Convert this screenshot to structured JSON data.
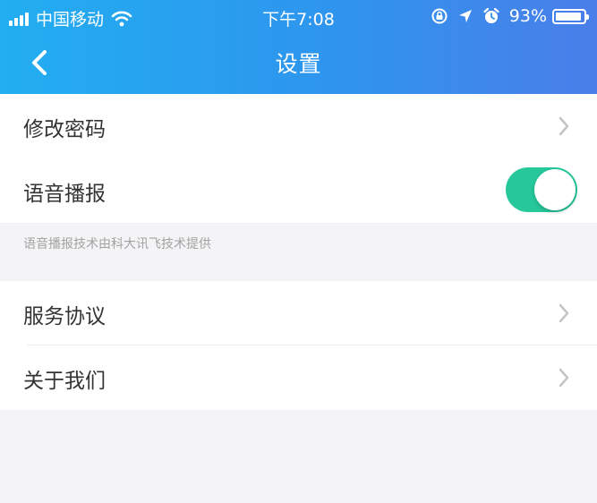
{
  "status_bar": {
    "carrier": "中国移动",
    "time": "下午7:08",
    "battery": "93%",
    "battery_level": 0.93,
    "icons": [
      "signal-icon",
      "wifi-icon",
      "orientation-lock-icon",
      "location-icon",
      "alarm-icon",
      "battery-icon"
    ]
  },
  "nav": {
    "title": "设置",
    "back_icon": "chevron-left-icon"
  },
  "settings": {
    "change_password": "修改密码",
    "voice_broadcast": "语音播报",
    "voice_broadcast_enabled": true,
    "voice_note": "语音播报技术由科大讯飞技术提供",
    "service_agreement": "服务协议",
    "about_us": "关于我们"
  },
  "colors": {
    "header_gradient_start": "#22aef0",
    "header_gradient_end": "#4a7ee9",
    "toggle_on": "#26c79b",
    "background": "#f4f4f6"
  }
}
